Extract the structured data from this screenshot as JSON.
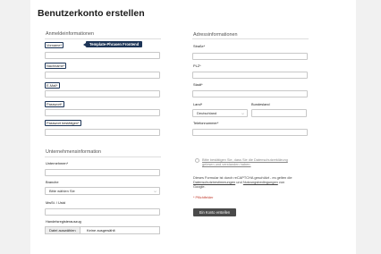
{
  "page_title": "Benutzerkonto erstellen",
  "tooltip": "Template-Phrasen Frontend",
  "login": {
    "heading": "Anmeldeinformationen",
    "vorname": "Vorname",
    "nachname": "Nachname",
    "email": "E-Mail",
    "passwort": "Passwort",
    "passwort_confirm": "Passwort bestätigen"
  },
  "address": {
    "heading": "Adressinformationen",
    "strasse": "Straße",
    "plz": "PLZ",
    "stadt": "Stadt",
    "land": "Land",
    "land_value": "Deutschland",
    "bundesland": "Bundesland",
    "telefon": "Telefonnummer"
  },
  "company": {
    "heading": "Unternehmensinformation",
    "unternehmen": "Unternehmen",
    "branche": "Branche",
    "branche_value": "Bitte wählen Sie",
    "mwst": "MwSt. / Ustd",
    "handelsregister": "Handelsregisterauszug",
    "file_button": "Datei auswählen",
    "file_status": "Keine ausgewählt"
  },
  "consent": {
    "line1": "Bitte bestätigen Sie, dass Sie die Datenschutzerklärung",
    "line2": "gelesen und verstanden haben."
  },
  "recaptcha": {
    "line1": "Dieses Formular ist durch reCAPTCHA geschützt - es gelten die",
    "link1": "Datenschutzbestimmungen",
    "and": "und",
    "link2": "Nutzungsbedingungen",
    "line2_end": "von",
    "line3": "Google."
  },
  "required_note": "* Pflichtfelder",
  "submit": "Ein Konto erstellen",
  "required_mark": "*"
}
